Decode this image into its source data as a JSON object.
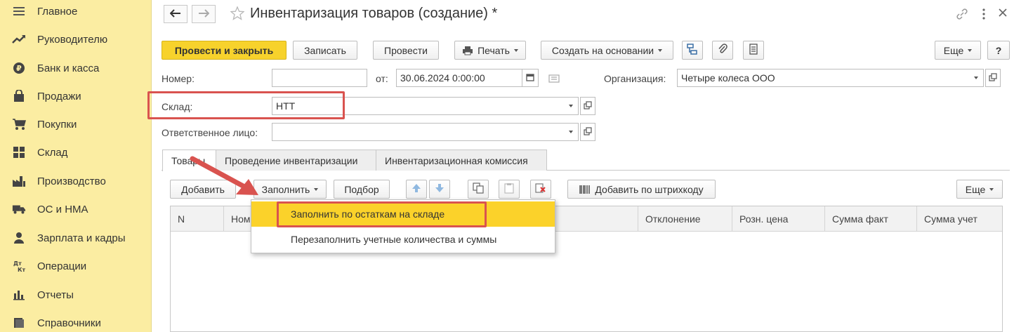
{
  "sidebar": {
    "items": [
      {
        "label": "Главное",
        "icon": "menu-lines-icon"
      },
      {
        "label": "Руководителю",
        "icon": "trend-chart-icon"
      },
      {
        "label": "Банк и касса",
        "icon": "coin-icon"
      },
      {
        "label": "Продажи",
        "icon": "shopping-bag-icon"
      },
      {
        "label": "Покупки",
        "icon": "cart-icon"
      },
      {
        "label": "Склад",
        "icon": "warehouse-icon"
      },
      {
        "label": "Производство",
        "icon": "factory-icon"
      },
      {
        "label": "ОС и НМА",
        "icon": "truck-icon"
      },
      {
        "label": "Зарплата и кадры",
        "icon": "person-icon"
      },
      {
        "label": "Операции",
        "icon": "dt-kt-icon"
      },
      {
        "label": "Отчеты",
        "icon": "bar-chart-icon"
      },
      {
        "label": "Справочники",
        "icon": "book-icon"
      }
    ]
  },
  "header": {
    "title": "Инвентаризация товаров (создание) *"
  },
  "toolbar": {
    "post_close": "Провести и закрыть",
    "save": "Записать",
    "post": "Провести",
    "print": "Печать",
    "create_based": "Создать на основании",
    "more": "Еще",
    "help": "?"
  },
  "form": {
    "number_label": "Номер:",
    "number_value": "",
    "from_label": "от:",
    "date_value": "30.06.2024  0:00:00",
    "org_label": "Организация:",
    "org_value": "Четыре колеса ООО",
    "warehouse_label": "Склад:",
    "warehouse_value": "НТТ",
    "responsible_label": "Ответственное лицо:",
    "responsible_value": ""
  },
  "tabs": [
    {
      "label": "Товары",
      "active": true
    },
    {
      "label": "Проведение инвентаризации",
      "active": false
    },
    {
      "label": "Инвентаризационная комиссия",
      "active": false
    }
  ],
  "table_toolbar": {
    "add": "Добавить",
    "fill": "Заполнить",
    "pick": "Подбор",
    "barcode": "Добавить по штрихкоду",
    "more": "Еще"
  },
  "table": {
    "columns": [
      "N",
      "Ном",
      "Отклонение",
      "Розн. цена",
      "Сумма факт",
      "Сумма учет"
    ]
  },
  "fill_menu": {
    "items": [
      {
        "label": "Заполнить по остаткам на складе",
        "highlighted": true
      },
      {
        "label": "Перезаполнить учетные количества и суммы",
        "highlighted": false
      }
    ]
  },
  "colors": {
    "sidebar_bg": "#fbeda2",
    "primary_button": "#f7d22c",
    "highlight": "#fbd22a",
    "annotation_red": "#d9534f"
  }
}
